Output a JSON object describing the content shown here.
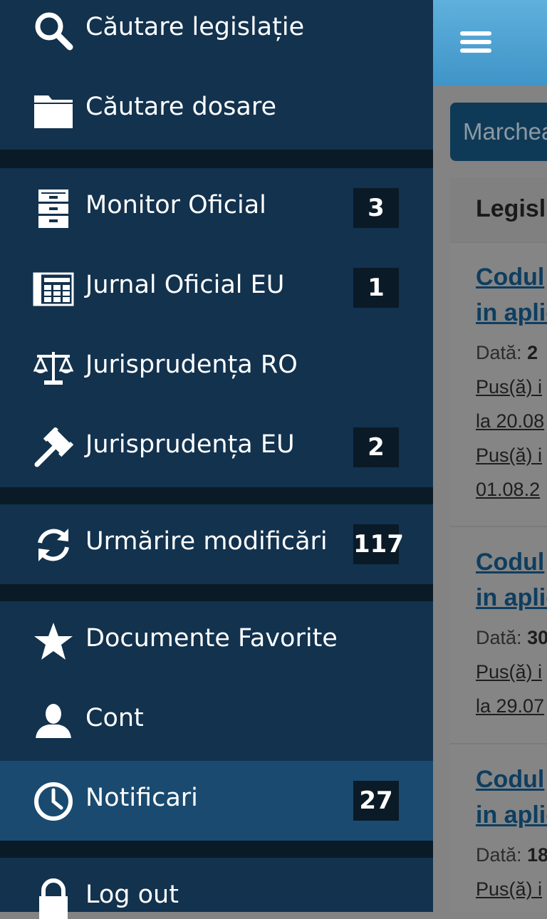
{
  "menu": {
    "search_legislation": "Căutare legislație",
    "search_files": "Căutare dosare",
    "monitor": {
      "label": "Monitor Oficial",
      "count": "3"
    },
    "journal_eu": {
      "label": "Jurnal Oficial EU",
      "count": "1"
    },
    "case_ro": "Jurisprudența RO",
    "case_eu": {
      "label": "Jurisprudența EU",
      "count": "2"
    },
    "tracking": {
      "label": "Urmărire modificări",
      "count": "117"
    },
    "favorites": "Documente Favorite",
    "account": "Cont",
    "notifications": {
      "label": "Notificari",
      "count": "27"
    },
    "logout": "Log out"
  },
  "icons": [
    "search-icon",
    "folder-icon",
    "cabinet-icon",
    "newspaper-icon",
    "scales-icon",
    "gavel-icon",
    "sync-icon",
    "star-icon",
    "user-icon",
    "clock-icon",
    "lock-icon",
    "hamburger-icon"
  ],
  "colors": {
    "drawer": "#12324e",
    "active": "#1a4a6f",
    "separator": "#0b1a27",
    "topbar": "#4aa3d6"
  },
  "content": {
    "mark_button": "Marchea",
    "panel_title": "Legisl",
    "docs": [
      {
        "title1": "Codul",
        "title2": "in aplic",
        "date_label": "Dată:",
        "date_value": "2",
        "line1": "Pus(ă) i",
        "line2": "la 20.08",
        "line3": "Pus(ă) i",
        "line4": "01.08.2"
      },
      {
        "title1": "Codul",
        "title2": "in aplic",
        "date_label": "Dată:",
        "date_value": "30",
        "line1": "Pus(ă) i",
        "line2": "la 29.07"
      },
      {
        "title1": "Codul",
        "title2": "in aplic",
        "date_label": "Dată:",
        "date_value": "18",
        "line1": "Pus(ă) i"
      }
    ]
  }
}
